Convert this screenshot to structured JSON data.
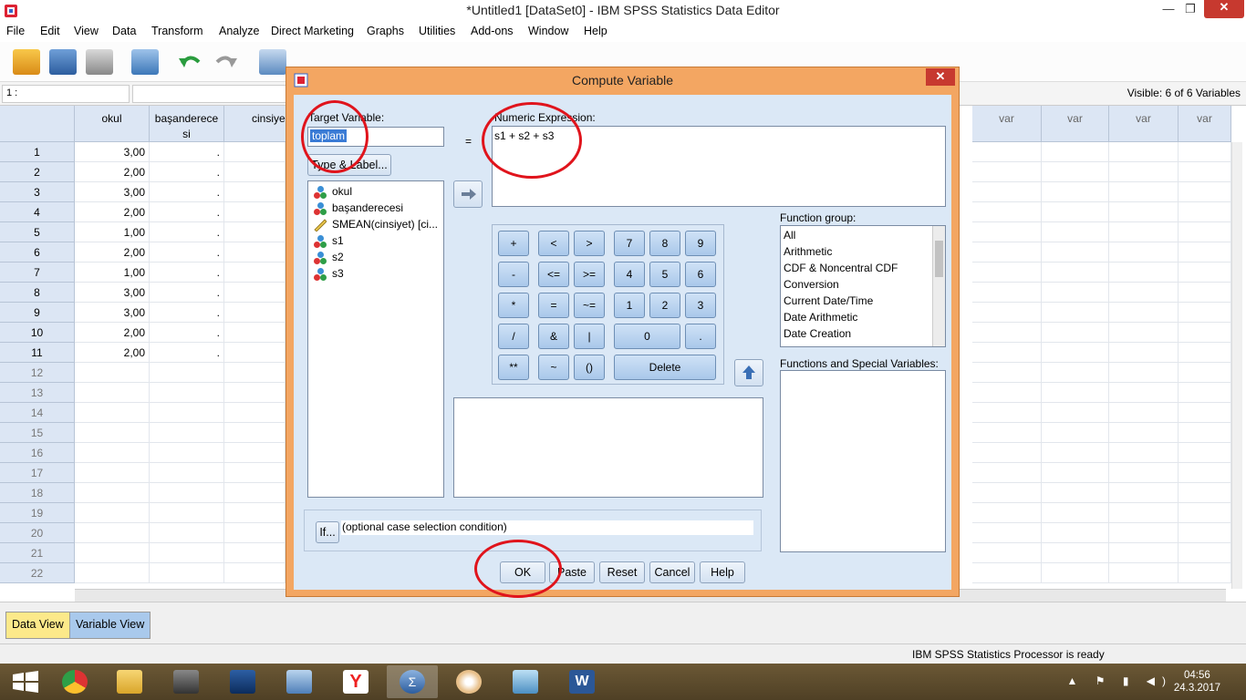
{
  "window": {
    "title": "*Untitled1 [DataSet0] - IBM SPSS Statistics Data Editor",
    "minimize": "—",
    "maximize": "❐",
    "close": "✕"
  },
  "menu": [
    "File",
    "Edit",
    "View",
    "Data",
    "Transform",
    "Analyze",
    "Direct Marketing",
    "Graphs",
    "Utilities",
    "Add-ons",
    "Window",
    "Help"
  ],
  "cellbar": {
    "ref": "1 :",
    "visible": "Visible: 6 of 6 Variables"
  },
  "grid": {
    "columns": [
      "okul",
      "başanderecesi",
      "cinsiye",
      "var",
      "var",
      "var",
      "var"
    ],
    "col_okul_line1": "okul",
    "col_basari_line1": "başanderece",
    "col_basari_line2": "si",
    "col_cins": "cinsiye",
    "rows": [
      {
        "n": "1",
        "okul": "3,00",
        "b": "."
      },
      {
        "n": "2",
        "okul": "2,00",
        "b": "."
      },
      {
        "n": "3",
        "okul": "3,00",
        "b": "."
      },
      {
        "n": "4",
        "okul": "2,00",
        "b": "."
      },
      {
        "n": "5",
        "okul": "1,00",
        "b": "."
      },
      {
        "n": "6",
        "okul": "2,00",
        "b": "."
      },
      {
        "n": "7",
        "okul": "1,00",
        "b": "."
      },
      {
        "n": "8",
        "okul": "3,00",
        "b": "."
      },
      {
        "n": "9",
        "okul": "3,00",
        "b": "."
      },
      {
        "n": "10",
        "okul": "2,00",
        "b": "."
      },
      {
        "n": "11",
        "okul": "2,00",
        "b": "."
      },
      {
        "n": "12",
        "okul": "",
        "b": ""
      },
      {
        "n": "13",
        "okul": "",
        "b": ""
      },
      {
        "n": "14",
        "okul": "",
        "b": ""
      },
      {
        "n": "15",
        "okul": "",
        "b": ""
      },
      {
        "n": "16",
        "okul": "",
        "b": ""
      },
      {
        "n": "17",
        "okul": "",
        "b": ""
      },
      {
        "n": "18",
        "okul": "",
        "b": ""
      },
      {
        "n": "19",
        "okul": "",
        "b": ""
      },
      {
        "n": "20",
        "okul": "",
        "b": ""
      },
      {
        "n": "21",
        "okul": "",
        "b": ""
      },
      {
        "n": "22",
        "okul": "",
        "b": ""
      }
    ],
    "var_label": "var"
  },
  "tabs": {
    "data_view": "Data View",
    "variable_view": "Variable View"
  },
  "status": "IBM SPSS Statistics Processor is ready",
  "clock": {
    "time": "04:56",
    "date": "24.3.2017"
  },
  "dialog": {
    "title": "Compute Variable",
    "target_label": "Target Variable:",
    "target_value": "toplam",
    "equals": "=",
    "expr_label": "Numeric Expression:",
    "expr_value": "s1 + s2 + s3",
    "type_label_btn": "Type & Label...",
    "variables": [
      "okul",
      "başanderecesi",
      "SMEAN(cinsiyet) [ci...",
      "s1",
      "s2",
      "s3"
    ],
    "keypad": {
      "r1": [
        "+",
        "<",
        ">",
        "7",
        "8",
        "9"
      ],
      "r2": [
        "-",
        "<=",
        ">=",
        "4",
        "5",
        "6"
      ],
      "r3": [
        "*",
        "=",
        "~=",
        "1",
        "2",
        "3"
      ],
      "r4": [
        "/",
        "&",
        "|",
        "0",
        "."
      ],
      "r5": [
        "**",
        "~",
        "()",
        "Delete"
      ]
    },
    "function_group_label": "Function group:",
    "function_groups": [
      "All",
      "Arithmetic",
      "CDF & Noncentral CDF",
      "Conversion",
      "Current Date/Time",
      "Date Arithmetic",
      "Date Creation"
    ],
    "functions_label": "Functions and Special Variables:",
    "if_btn": "If...",
    "if_text": "(optional case selection condition)",
    "buttons": {
      "ok": "OK",
      "paste": "Paste",
      "reset": "Reset",
      "cancel": "Cancel",
      "help": "Help"
    }
  },
  "colors": {
    "dialog_frame": "#f3a662",
    "dialog_body": "#dbe8f6",
    "grid_header": "#dce6f4",
    "annotation": "#e0141c"
  }
}
